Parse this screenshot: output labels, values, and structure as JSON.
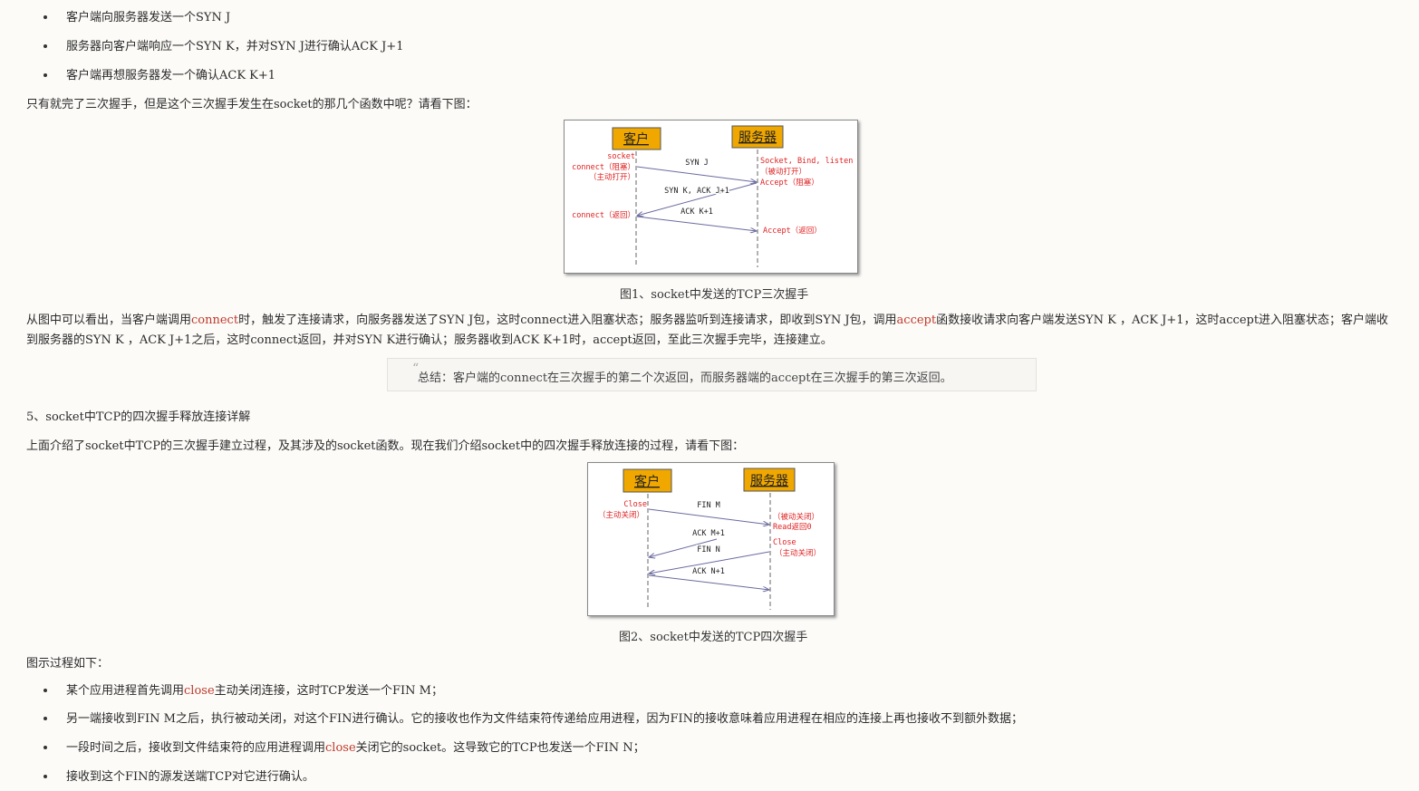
{
  "top_bullets": [
    "客户端向服务器发送一个SYN J",
    "服务器向客户端响应一个SYN K，并对SYN J进行确认ACK J+1",
    "客户端再想服务器发一个确认ACK K+1"
  ],
  "intro_text": "只有就完了三次握手，但是这个三次握手发生在socket的那几个函数中呢？请看下图：",
  "figure1": {
    "client_label": "客户",
    "server_label": "服务器",
    "client_notes": [
      "socket",
      "connect（阻塞）",
      "（主动打开）",
      "connect（返回）"
    ],
    "server_notes": [
      "Socket, Bind, listen",
      "（被动打开）",
      "Accept（阻塞）",
      "Accept（返回）"
    ],
    "msg1": "SYN J",
    "msg2": "SYN K, ACK J+1",
    "msg3": "ACK K+1",
    "caption": "图1、socket中发送的TCP三次握手"
  },
  "para1": {
    "p1": "从图中可以看出，当客户端调用",
    "connect": "connect",
    "p2": "时，触发了连接请求，向服务器发送了SYN J包，这时connect进入阻塞状态；服务器监听到连接请求，即收到SYN J包，调用",
    "accept": "accept",
    "p3": "函数接收请求向客户端发送SYN K ，ACK J+1，这时accept进入阻塞状态；客户端收到服务器的SYN K ，ACK J+1之后，这时connect返回，并对SYN K进行确认；服务器收到ACK K+1时，accept返回，至此三次握手完毕，连接建立。"
  },
  "quote": {
    "mark": "“",
    "text": "总结：客户端的connect在三次握手的第二个次返回，而服务器端的accept在三次握手的第三次返回。"
  },
  "section_heading": "5、socket中TCP的四次握手释放连接详解",
  "section_intro": "上面介绍了socket中TCP的三次握手建立过程，及其涉及的socket函数。现在我们介绍socket中的四次握手释放连接的过程，请看下图：",
  "figure2": {
    "client_label": "客户",
    "server_label": "服务器",
    "client_notes": [
      "Close",
      "（主动关闭）"
    ],
    "server_notes": [
      "（被动关闭）",
      "Read返回0",
      "Close",
      "（主动关闭）"
    ],
    "msg1": "FIN M",
    "msg2": "ACK M+1",
    "msg3": "FIN N",
    "msg4": "ACK N+1",
    "caption": "图2、socket中发送的TCP四次握手"
  },
  "process_label": "图示过程如下：",
  "bottom_bullets": [
    {
      "p1": "某个应用进程首先调用",
      "red": "close",
      "p2": "主动关闭连接，这时TCP发送一个FIN M；"
    },
    {
      "p1": "另一端接收到FIN M之后，执行被动关闭，对这个FIN进行确认。它的接收也作为文件结束符传递给应用进程，因为FIN的接收意味着应用进程在相应的连接上再也接收不到额外数据；",
      "red": "",
      "p2": ""
    },
    {
      "p1": "一段时间之后，接收到文件结束符的应用进程调用",
      "red": "close",
      "p2": "关闭它的socket。这导致它的TCP也发送一个FIN N；"
    },
    {
      "p1": "接收到这个FIN的源发送端TCP对它进行确认。",
      "red": "",
      "p2": ""
    }
  ],
  "colors": {
    "box_fill": "#f0a800",
    "note_red": "#e02020",
    "link_red": "#c0392b"
  }
}
